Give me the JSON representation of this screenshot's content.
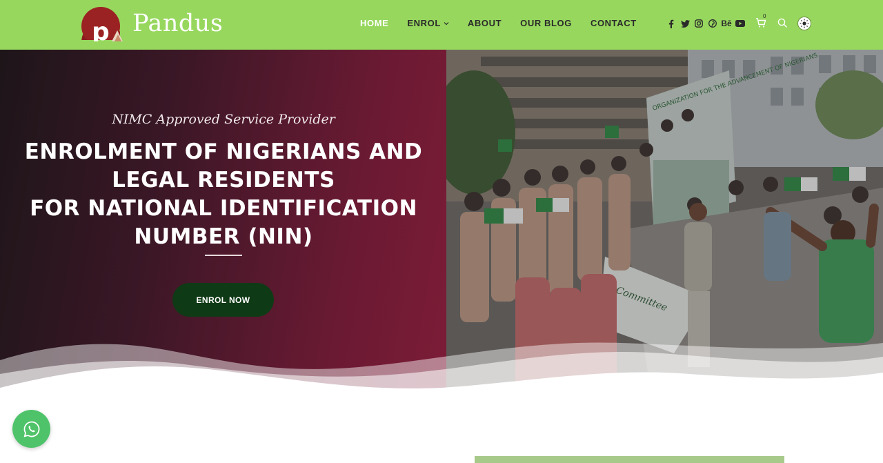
{
  "brand": {
    "name": "Pandus",
    "logo_letter": "p",
    "header_color": "#97d75e",
    "accent_dark_green": "#0f3a16",
    "hero_maroon": "#7e1c38"
  },
  "nav": {
    "items": [
      {
        "label": "HOME",
        "active": true
      },
      {
        "label": "ENROL",
        "has_dropdown": true
      },
      {
        "label": "ABOUT"
      },
      {
        "label": "OUR BLOG"
      },
      {
        "label": "CONTACT"
      }
    ]
  },
  "social": {
    "icons": [
      "facebook-icon",
      "twitter-icon",
      "instagram-icon",
      "pinterest-icon",
      "behance-icon",
      "youtube-icon"
    ],
    "behance_label": "Bē"
  },
  "header_tools": {
    "cart_count": "0",
    "icons": [
      "cart-icon",
      "search-icon",
      "theme-toggle-icon"
    ]
  },
  "hero": {
    "subtitle": "NIMC Approved Service Provider",
    "headline_lines": [
      "ENROLMENT OF NIGERIANS AND",
      "LEGAL RESIDENTS",
      "FOR NATIONAL IDENTIFICATION",
      "NUMBER (NIN)"
    ],
    "cta_label": "ENROL NOW",
    "photo_banner_text": "ORGANIZATION FOR THE ADVANCEMENT OF NIGERIANS",
    "photo_float_text": "Committee"
  },
  "floating": {
    "whatsapp_icon": "whatsapp-icon",
    "whatsapp_color": "#4fc36a"
  }
}
